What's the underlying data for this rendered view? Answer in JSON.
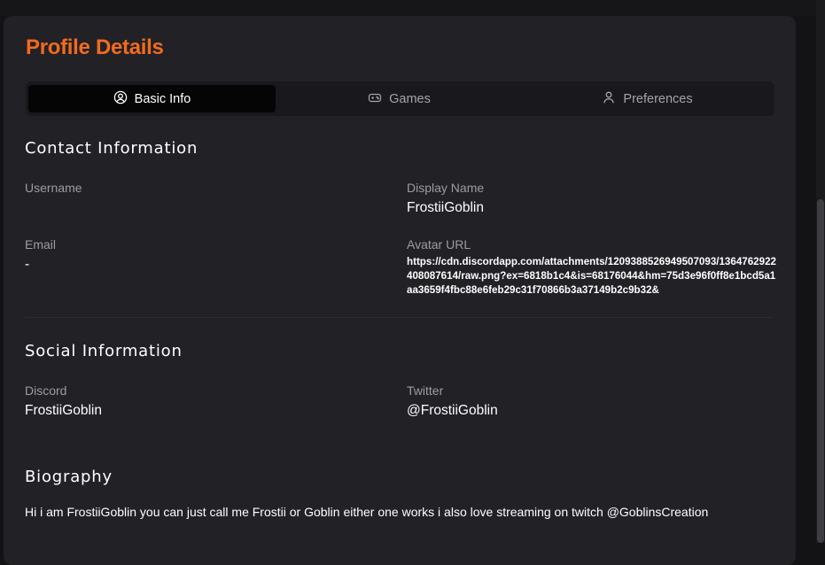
{
  "profile": {
    "title": "Profile Details",
    "accent_color": "#f26b1d"
  },
  "tabs": [
    {
      "label": "Basic Info",
      "icon": "user-circle-icon",
      "active": true
    },
    {
      "label": "Games",
      "icon": "gamepad-icon",
      "active": false
    },
    {
      "label": "Preferences",
      "icon": "person-icon",
      "active": false
    }
  ],
  "contact": {
    "heading": "Contact Information",
    "username_label": "Username",
    "username_value": "",
    "display_name_label": "Display Name",
    "display_name_value": "FrostiiGoblin",
    "email_label": "Email",
    "email_value": "-",
    "avatar_label": "Avatar URL",
    "avatar_value": "https://cdn.discordapp.com/attachments/1209388526949507093/1364762922408087614/raw.png?ex=6818b1c4&is=68176044&hm=75d3e96f0ff8e1bcd5a1aa3659f4fbc88e6feb29c31f70866b3a37149b2c9b32&"
  },
  "social": {
    "heading": "Social Information",
    "discord_label": "Discord",
    "discord_value": "FrostiiGoblin",
    "twitter_label": "Twitter",
    "twitter_value": "@FrostiiGoblin"
  },
  "biography": {
    "heading": "Biography",
    "text": "Hi i am FrostiiGoblin you can just call me Frostii or Goblin either one works i also love streaming on twitch @GoblinsCreation"
  }
}
